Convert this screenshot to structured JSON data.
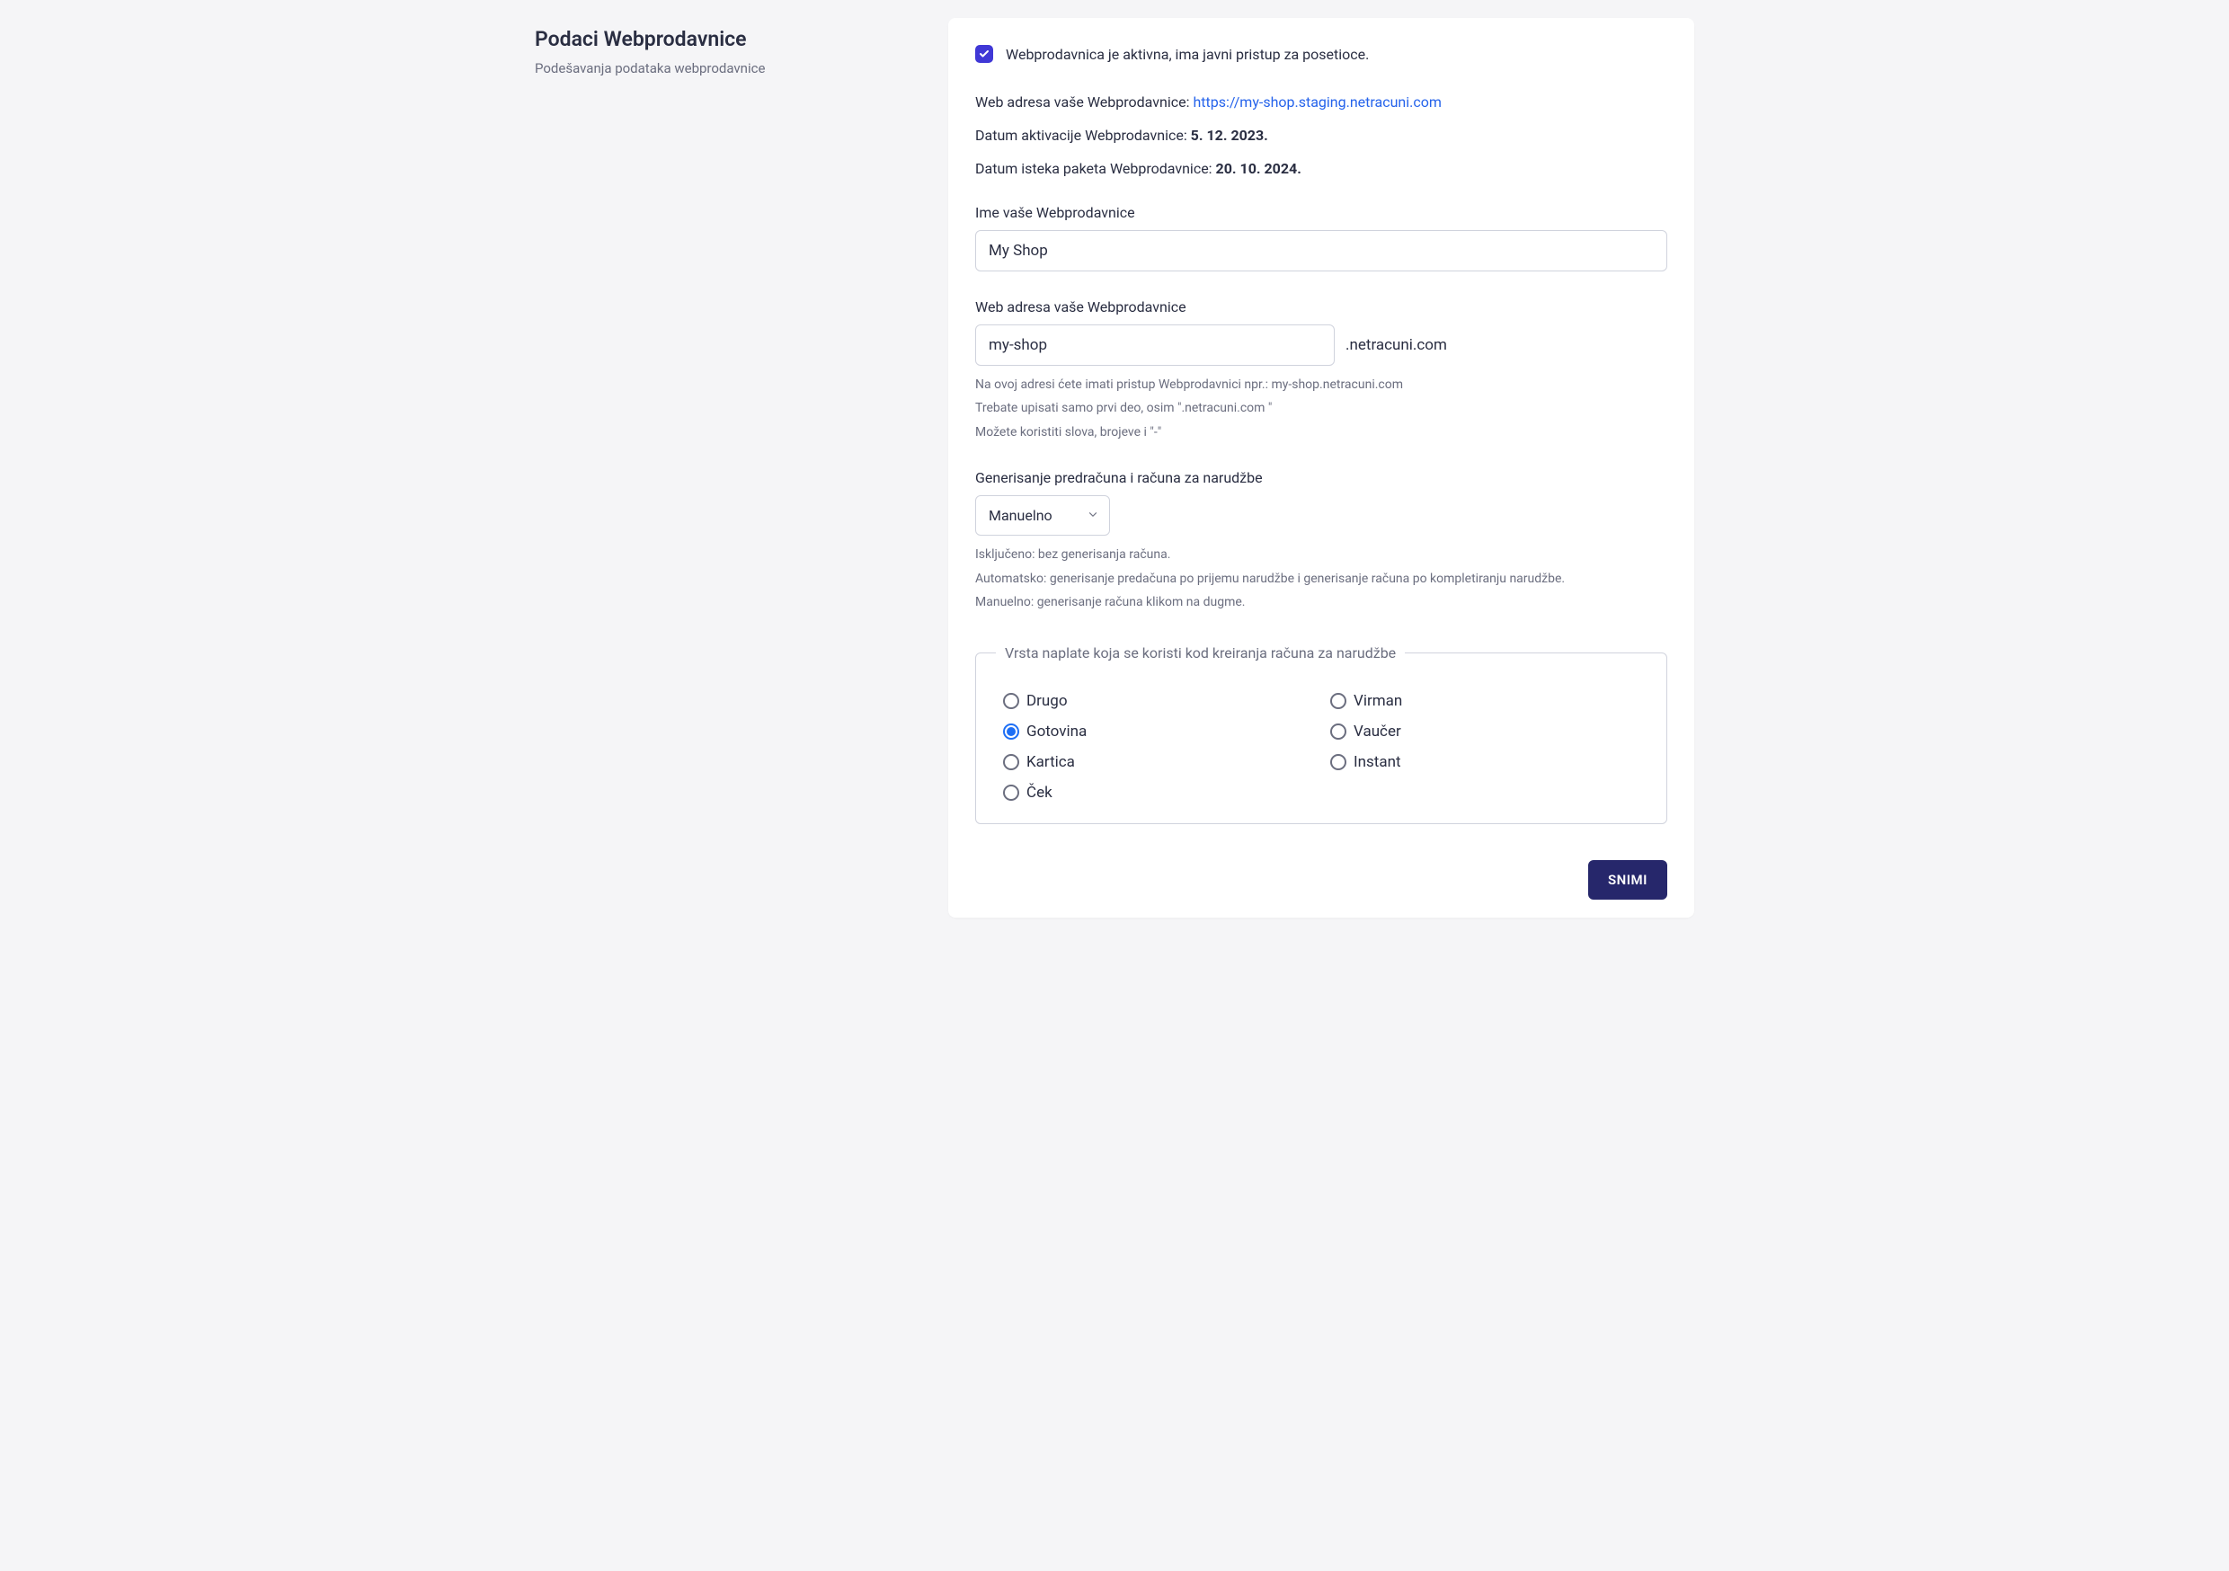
{
  "sidebar": {
    "title": "Podaci Webprodavnice",
    "subtitle": "Podešavanja podataka webprodavnice"
  },
  "active_checkbox": {
    "label": "Webprodavnica je aktivna, ima javni pristup za posetioce.",
    "checked": true
  },
  "info": {
    "web_address_label": "Web adresa vaše Webprodavnice: ",
    "web_address_url": "https://my-shop.staging.netracuni.com",
    "activation_label": "Datum aktivacije Webprodavnice: ",
    "activation_date": "5. 12. 2023.",
    "expiry_label": "Datum isteka paketa Webprodavnice: ",
    "expiry_date": "20. 10. 2024."
  },
  "shop_name": {
    "label": "Ime vaše Webprodavnice",
    "value": "My Shop"
  },
  "shop_address": {
    "label": "Web adresa vaše Webprodavnice",
    "value": "my-shop",
    "suffix": ".netracuni.com",
    "help1": "Na ovoj adresi ćete imati pristup Webprodavnici npr.: my-shop.netracuni.com",
    "help2": "Trebate upisati samo prvi deo, osim \".netracuni.com \"",
    "help3": "Možete koristiti slova, brojeve i \"-\""
  },
  "invoice_gen": {
    "label": "Generisanje predračuna i računa za narudžbe",
    "value": "Manuelno",
    "help1": "Isključeno: bez generisanja računa.",
    "help2": "Automatsko: generisanje predačuna po prijemu narudžbe i generisanje računa po kompletiranju narudžbe.",
    "help3": "Manuelno: generisanje računa klikom na dugme."
  },
  "payment_type": {
    "legend": "Vrsta naplate koja se koristi kod kreiranja računa za narudžbe",
    "selected": "Gotovina",
    "options_left": [
      "Drugo",
      "Gotovina",
      "Kartica",
      "Ček"
    ],
    "options_right": [
      "Virman",
      "Vaučer",
      "Instant"
    ]
  },
  "footer": {
    "save_label": "SNIMI"
  }
}
